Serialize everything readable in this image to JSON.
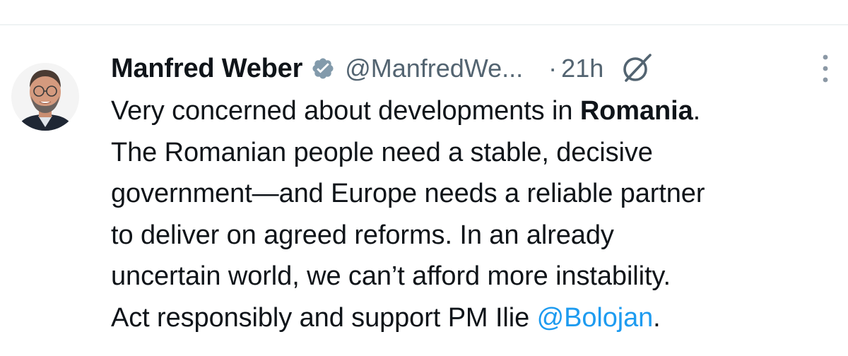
{
  "tweet": {
    "author": {
      "display_name": "Manfred Weber",
      "handle": "@ManfredWe...",
      "verified": true,
      "verified_color": "#829aab",
      "avatar_icon": "profile-photo"
    },
    "separator": "·",
    "timestamp": "21h",
    "grok_icon": "grok-slash-icon",
    "more_icon": "more-vertical-icon",
    "text": {
      "line1_a": "Very concerned about developments in ",
      "line1_bold": "Romania",
      "line1_b": ".",
      "line2": "The Romanian people need a stable, decisive",
      "line3": "government—and Europe needs a reliable partner",
      "line4": "to deliver on agreed reforms. In an already",
      "line5": "uncertain world, we can’t afford more instability.",
      "line6_a": "Act responsibly and support PM Ilie ",
      "line6_mention": "@Bolojan",
      "line6_b": "."
    },
    "colors": {
      "text": "#0f1419",
      "secondary": "#536471",
      "link": "#1d9bf0",
      "divider": "#eff3f4"
    }
  }
}
